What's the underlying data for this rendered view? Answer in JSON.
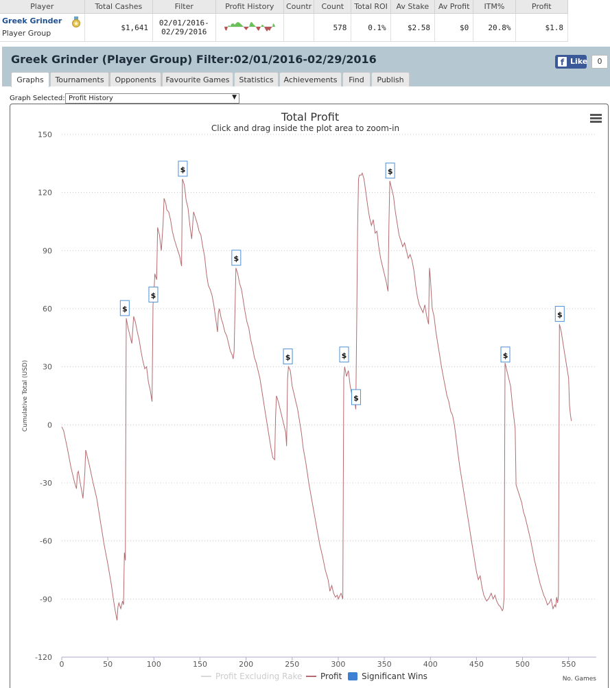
{
  "summary": {
    "headers": [
      "Player",
      "Total Cashes",
      "Filter",
      "Profit History",
      "Countr",
      "Count",
      "Total ROI",
      "Av Stake",
      "Av Profit",
      "ITM%",
      "Profit"
    ],
    "player_name": "Greek Grinder",
    "player_type": "Player Group",
    "total_cashes": "$1,641",
    "filter_line1": "02/01/2016-",
    "filter_line2": "02/29/2016",
    "country": "",
    "count": "578",
    "total_roi": "0.1%",
    "av_stake": "$2.58",
    "av_profit": "$0",
    "itm": "20.8%",
    "profit": "$1.8"
  },
  "header": {
    "title": "Greek Grinder (Player Group) Filter:02/01/2016-02/29/2016",
    "like_label": "Like",
    "like_count": "0"
  },
  "tabs": [
    {
      "label": "Graphs",
      "active": true
    },
    {
      "label": "Tournaments"
    },
    {
      "label": "Opponents"
    },
    {
      "label": "Favourite Games"
    },
    {
      "label": "Statistics"
    },
    {
      "label": "Achievements"
    },
    {
      "label": "Find"
    },
    {
      "label": "Publish"
    }
  ],
  "graph_select": {
    "label": "Graph Selected:",
    "value": "Profit History"
  },
  "chart_data": {
    "type": "line",
    "title": "Total Profit",
    "subtitle": "Click and drag inside the plot area to zoom-in",
    "ylabel": "Cumulative Total (USD)",
    "xlabel": "No. Games",
    "xlim": [
      0,
      580
    ],
    "ylim": [
      -120,
      150
    ],
    "xticks": [
      0,
      50,
      100,
      150,
      200,
      250,
      300,
      350,
      400,
      450,
      500,
      550
    ],
    "yticks": [
      -120,
      -90,
      -60,
      -30,
      0,
      30,
      60,
      90,
      120,
      150
    ],
    "grid": "horizontal dotted",
    "legend": {
      "placement": "bottom-center",
      "items": [
        {
          "label": "Profit Excluding Rake",
          "color": "#d9d9d9",
          "kind": "line"
        },
        {
          "label": "Profit",
          "color": "#b56a6f",
          "kind": "line"
        },
        {
          "label": "Significant Wins",
          "color": "#3d7fd1",
          "kind": "box"
        }
      ]
    },
    "line_color": "#b56a6f",
    "series": [
      {
        "name": "Profit",
        "points": [
          [
            0,
            -1
          ],
          [
            2,
            -3
          ],
          [
            6,
            -12
          ],
          [
            10,
            -22
          ],
          [
            14,
            -30
          ],
          [
            16,
            -33
          ],
          [
            17,
            -25
          ],
          [
            18,
            -24
          ],
          [
            20,
            -30
          ],
          [
            22,
            -35
          ],
          [
            23,
            -38
          ],
          [
            25,
            -25
          ],
          [
            26,
            -13
          ],
          [
            28,
            -17
          ],
          [
            30,
            -21
          ],
          [
            34,
            -30
          ],
          [
            38,
            -38
          ],
          [
            42,
            -50
          ],
          [
            46,
            -62
          ],
          [
            50,
            -72
          ],
          [
            54,
            -83
          ],
          [
            56,
            -90
          ],
          [
            58,
            -96
          ],
          [
            60,
            -101
          ],
          [
            61,
            -94
          ],
          [
            62,
            -92
          ],
          [
            64,
            -95
          ],
          [
            66,
            -91
          ],
          [
            67,
            -93
          ],
          [
            68,
            -66
          ],
          [
            69,
            -70
          ],
          [
            69.5,
            -5
          ],
          [
            70,
            55
          ],
          [
            72,
            50
          ],
          [
            74,
            46
          ],
          [
            76,
            42
          ],
          [
            78,
            56
          ],
          [
            80,
            53
          ],
          [
            82,
            48
          ],
          [
            84,
            44
          ],
          [
            86,
            38
          ],
          [
            88,
            33
          ],
          [
            90,
            29
          ],
          [
            92,
            30
          ],
          [
            94,
            22
          ],
          [
            96,
            18
          ],
          [
            98,
            12
          ],
          [
            99,
            62
          ],
          [
            100,
            68
          ],
          [
            101,
            78
          ],
          [
            103,
            75
          ],
          [
            104,
            102
          ],
          [
            106,
            98
          ],
          [
            108,
            90
          ],
          [
            110,
            104
          ],
          [
            111,
            117
          ],
          [
            113,
            114
          ],
          [
            114,
            111
          ],
          [
            116,
            110
          ],
          [
            118,
            106
          ],
          [
            120,
            100
          ],
          [
            122,
            96
          ],
          [
            124,
            93
          ],
          [
            126,
            90
          ],
          [
            128,
            87
          ],
          [
            130,
            82
          ],
          [
            131,
            127
          ],
          [
            133,
            124
          ],
          [
            135,
            116
          ],
          [
            137,
            112
          ],
          [
            139,
            103
          ],
          [
            141,
            96
          ],
          [
            143,
            110
          ],
          [
            145,
            107
          ],
          [
            147,
            104
          ],
          [
            149,
            100
          ],
          [
            151,
            98
          ],
          [
            153,
            92
          ],
          [
            155,
            87
          ],
          [
            157,
            78
          ],
          [
            159,
            72
          ],
          [
            161,
            70
          ],
          [
            163,
            67
          ],
          [
            165,
            62
          ],
          [
            167,
            55
          ],
          [
            169,
            48
          ],
          [
            170,
            58
          ],
          [
            171,
            60
          ],
          [
            173,
            55
          ],
          [
            175,
            52
          ],
          [
            177,
            48
          ],
          [
            179,
            46
          ],
          [
            181,
            42
          ],
          [
            183,
            38
          ],
          [
            185,
            36
          ],
          [
            186,
            34
          ],
          [
            187,
            38
          ],
          [
            189,
            81
          ],
          [
            191,
            78
          ],
          [
            193,
            73
          ],
          [
            195,
            70
          ],
          [
            197,
            64
          ],
          [
            199,
            58
          ],
          [
            201,
            53
          ],
          [
            203,
            50
          ],
          [
            205,
            44
          ],
          [
            207,
            40
          ],
          [
            209,
            35
          ],
          [
            211,
            32
          ],
          [
            213,
            28
          ],
          [
            215,
            24
          ],
          [
            217,
            18
          ],
          [
            219,
            12
          ],
          [
            221,
            6
          ],
          [
            223,
            0
          ],
          [
            225,
            -6
          ],
          [
            227,
            -12
          ],
          [
            229,
            -17
          ],
          [
            231,
            -18
          ],
          [
            232,
            4
          ],
          [
            233,
            15
          ],
          [
            235,
            12
          ],
          [
            237,
            8
          ],
          [
            239,
            4
          ],
          [
            241,
            0
          ],
          [
            243,
            -4
          ],
          [
            244,
            -11
          ],
          [
            245,
            24
          ],
          [
            246,
            30
          ],
          [
            248,
            28
          ],
          [
            250,
            20
          ],
          [
            252,
            16
          ],
          [
            254,
            12
          ],
          [
            256,
            8
          ],
          [
            258,
            2
          ],
          [
            260,
            -4
          ],
          [
            262,
            -12
          ],
          [
            265,
            -20
          ],
          [
            268,
            -30
          ],
          [
            271,
            -38
          ],
          [
            274,
            -46
          ],
          [
            277,
            -54
          ],
          [
            280,
            -62
          ],
          [
            283,
            -68
          ],
          [
            286,
            -75
          ],
          [
            289,
            -80
          ],
          [
            291,
            -86
          ],
          [
            293,
            -83
          ],
          [
            295,
            -87
          ],
          [
            297,
            -89
          ],
          [
            299,
            -88
          ],
          [
            300,
            -90
          ],
          [
            301,
            -89
          ],
          [
            302,
            -88
          ],
          [
            303,
            -87
          ],
          [
            305,
            -90
          ],
          [
            306,
            24
          ],
          [
            307,
            30
          ],
          [
            309,
            25
          ],
          [
            311,
            28
          ],
          [
            313,
            20
          ],
          [
            315,
            15
          ],
          [
            317,
            18
          ],
          [
            318,
            12
          ],
          [
            319,
            8
          ],
          [
            320,
            50
          ],
          [
            321,
            100
          ],
          [
            322,
            127
          ],
          [
            323,
            129
          ],
          [
            325,
            129
          ],
          [
            326,
            130
          ],
          [
            328,
            127
          ],
          [
            330,
            120
          ],
          [
            332,
            113
          ],
          [
            334,
            107
          ],
          [
            336,
            103
          ],
          [
            338,
            106
          ],
          [
            340,
            99
          ],
          [
            342,
            100
          ],
          [
            344,
            92
          ],
          [
            346,
            86
          ],
          [
            348,
            82
          ],
          [
            350,
            78
          ],
          [
            352,
            74
          ],
          [
            354,
            69
          ],
          [
            355,
            103
          ],
          [
            356,
            126
          ],
          [
            358,
            122
          ],
          [
            360,
            118
          ],
          [
            362,
            110
          ],
          [
            364,
            104
          ],
          [
            366,
            98
          ],
          [
            368,
            95
          ],
          [
            370,
            92
          ],
          [
            372,
            94
          ],
          [
            374,
            90
          ],
          [
            376,
            86
          ],
          [
            378,
            88
          ],
          [
            380,
            85
          ],
          [
            382,
            80
          ],
          [
            384,
            72
          ],
          [
            386,
            66
          ],
          [
            388,
            62
          ],
          [
            390,
            60
          ],
          [
            392,
            58
          ],
          [
            394,
            62
          ],
          [
            396,
            56
          ],
          [
            398,
            52
          ],
          [
            399,
            81
          ],
          [
            400,
            76
          ],
          [
            402,
            60
          ],
          [
            404,
            56
          ],
          [
            406,
            48
          ],
          [
            408,
            42
          ],
          [
            410,
            36
          ],
          [
            412,
            30
          ],
          [
            414,
            25
          ],
          [
            416,
            20
          ],
          [
            418,
            15
          ],
          [
            420,
            12
          ],
          [
            422,
            7
          ],
          [
            424,
            5
          ],
          [
            426,
            0
          ],
          [
            428,
            -7
          ],
          [
            430,
            -15
          ],
          [
            432,
            -22
          ],
          [
            434,
            -28
          ],
          [
            436,
            -34
          ],
          [
            438,
            -40
          ],
          [
            440,
            -46
          ],
          [
            442,
            -52
          ],
          [
            444,
            -58
          ],
          [
            446,
            -64
          ],
          [
            448,
            -70
          ],
          [
            450,
            -76
          ],
          [
            452,
            -80
          ],
          [
            454,
            -78
          ],
          [
            456,
            -84
          ],
          [
            458,
            -88
          ],
          [
            460,
            -90
          ],
          [
            461,
            -91
          ],
          [
            463,
            -90
          ],
          [
            466,
            -87
          ],
          [
            468,
            -90
          ],
          [
            470,
            -88
          ],
          [
            472,
            -91
          ],
          [
            474,
            -93
          ],
          [
            476,
            -94
          ],
          [
            478,
            -96
          ],
          [
            479,
            -95
          ],
          [
            480,
            -89
          ],
          [
            481,
            32
          ],
          [
            483,
            28
          ],
          [
            485,
            24
          ],
          [
            487,
            20
          ],
          [
            489,
            10
          ],
          [
            491,
            2
          ],
          [
            492,
            -2
          ],
          [
            493,
            -31
          ],
          [
            495,
            -34
          ],
          [
            497,
            -37
          ],
          [
            499,
            -40
          ],
          [
            501,
            -45
          ],
          [
            503,
            -48
          ],
          [
            505,
            -52
          ],
          [
            507,
            -56
          ],
          [
            509,
            -60
          ],
          [
            511,
            -65
          ],
          [
            513,
            -70
          ],
          [
            515,
            -74
          ],
          [
            517,
            -78
          ],
          [
            519,
            -82
          ],
          [
            521,
            -85
          ],
          [
            523,
            -88
          ],
          [
            525,
            -90
          ],
          [
            527,
            -93
          ],
          [
            529,
            -92
          ],
          [
            531,
            -90
          ],
          [
            533,
            -95
          ],
          [
            535,
            -93
          ],
          [
            536,
            -94
          ],
          [
            537,
            -89
          ],
          [
            538,
            -92
          ],
          [
            539,
            -88
          ],
          [
            540,
            52
          ],
          [
            542,
            48
          ],
          [
            544,
            42
          ],
          [
            546,
            36
          ],
          [
            548,
            30
          ],
          [
            550,
            24
          ],
          [
            551,
            10
          ],
          [
            552,
            5
          ],
          [
            553,
            2
          ]
        ]
      }
    ],
    "significant_wins": [
      {
        "x": 68,
        "y": 55,
        "label": "$"
      },
      {
        "x": 99,
        "y": 62,
        "label": "$"
      },
      {
        "x": 131,
        "y": 127,
        "label": "$"
      },
      {
        "x": 189,
        "y": 81,
        "label": "$"
      },
      {
        "x": 245,
        "y": 30,
        "label": "$"
      },
      {
        "x": 306,
        "y": 31,
        "label": "$"
      },
      {
        "x": 319,
        "y": 9,
        "label": "$"
      },
      {
        "x": 356,
        "y": 126,
        "label": "$"
      },
      {
        "x": 481,
        "y": 31,
        "label": "$"
      },
      {
        "x": 540,
        "y": 52,
        "label": "$"
      }
    ]
  }
}
